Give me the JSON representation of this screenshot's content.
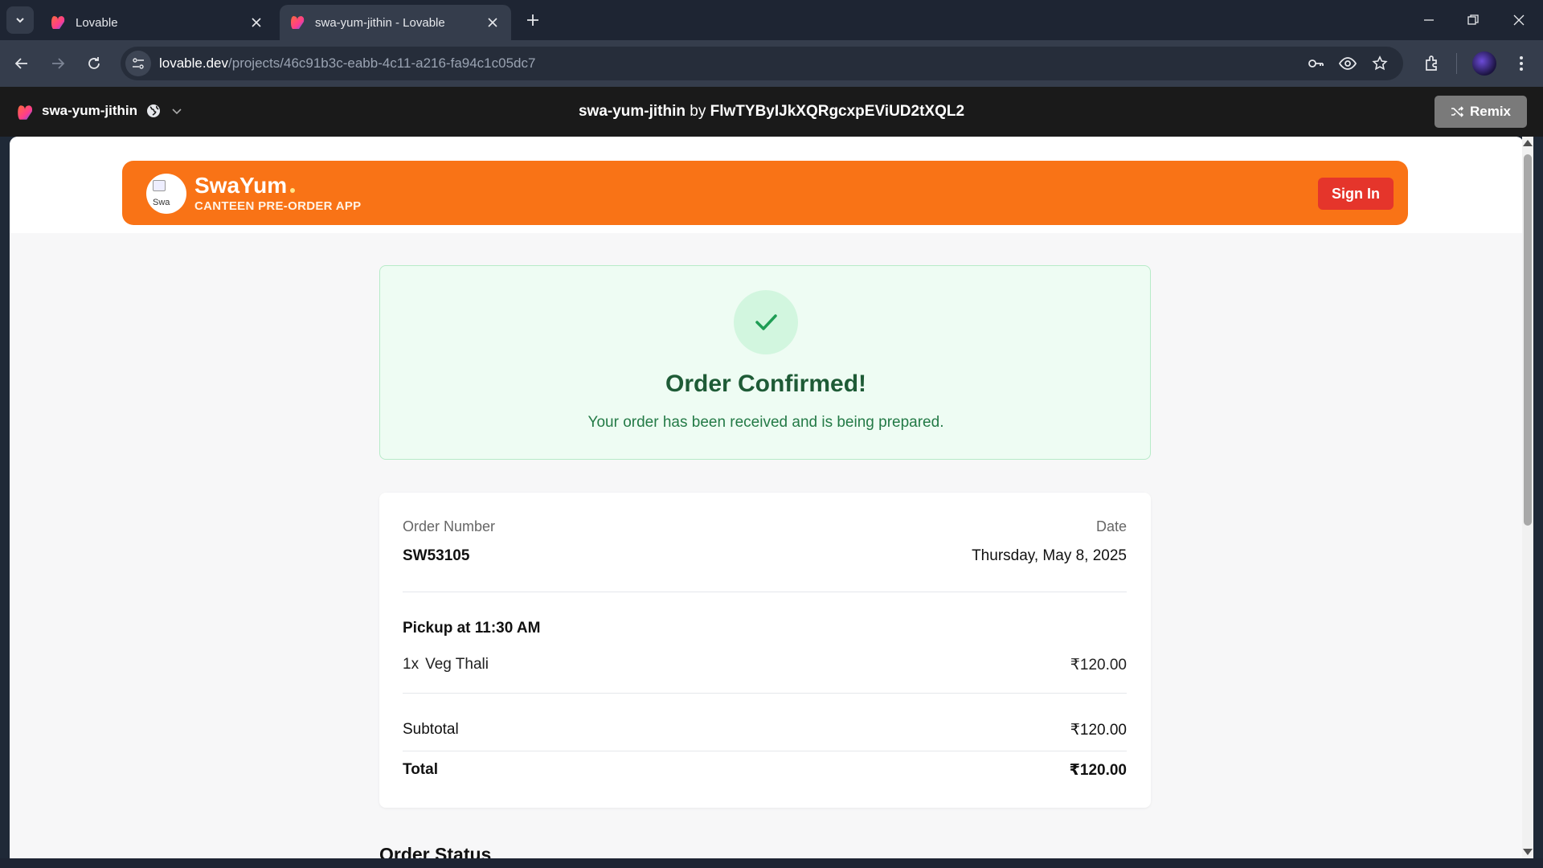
{
  "browser": {
    "tabs": [
      {
        "title": "Lovable",
        "active": false
      },
      {
        "title": "swa-yum-jithin - Lovable",
        "active": true
      }
    ],
    "url_host": "lovable.dev",
    "url_path": "/projects/46c91b3c-eabb-4c11-a216-fa94c1c05dc7"
  },
  "lovable": {
    "project_name": "swa-yum-jithin",
    "center_project": "swa-yum-jithin",
    "center_by": "by",
    "center_owner": "FlwTYByIJkXQRgcxpEViUD2tXQL2",
    "remix_label": "Remix"
  },
  "app": {
    "brand": "SwaYum",
    "tagline": "CANTEEN PRE-ORDER APP",
    "logo_alt": "Swa",
    "signin_label": "Sign In",
    "colors": {
      "header": "#f97316",
      "signin": "#e5352b",
      "success": "#1e5b36"
    }
  },
  "confirmation": {
    "title": "Order Confirmed!",
    "subtitle": "Your order has been received and is being prepared."
  },
  "order": {
    "number_label": "Order Number",
    "number": "SW53105",
    "date_label": "Date",
    "date": "Thursday, May 8, 2025",
    "pickup": "Pickup at 11:30 AM",
    "items": [
      {
        "qty": "1x",
        "name": "Veg Thali",
        "price": "₹120.00"
      }
    ],
    "subtotal_label": "Subtotal",
    "subtotal": "₹120.00",
    "total_label": "Total",
    "total": "₹120.00"
  },
  "status": {
    "title": "Order Status"
  }
}
